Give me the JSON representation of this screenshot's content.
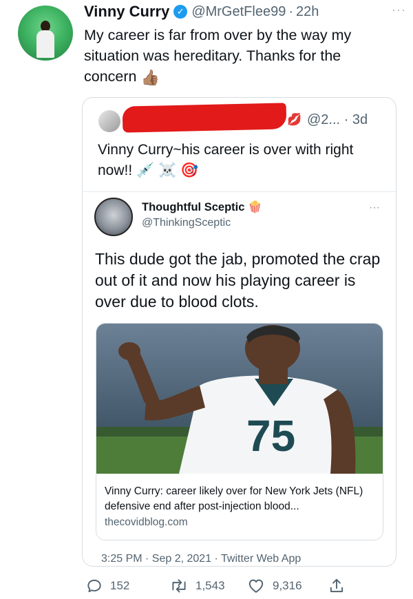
{
  "tweet": {
    "author_name": "Vinny Curry",
    "handle": "@MrGetFlee99",
    "separator": "·",
    "time_ago": "22h",
    "more": "···",
    "text": "My career is far from over by the way my situation was hereditary. Thanks for the concern",
    "thumb_emoji": "👍🏽",
    "timestamp": "3:25 PM · Sep 2, 2021 · Twitter Web App",
    "stats": {
      "replies": "152",
      "retweets": "1,543",
      "likes": "9,316"
    }
  },
  "quote": {
    "heart_emoji": "💋",
    "handle_meta": "@2... · 3d",
    "text": "Vinny Curry~his career is over with right now!!",
    "emojis": "💉 ☠️ 🎯"
  },
  "nested": {
    "author_name": "Thoughtful Sceptic",
    "name_emoji": "🍿",
    "handle": "@ThinkingSceptic",
    "more": "···",
    "text": "This dude got the jab, promoted the crap out of it and now his playing career is over due to blood clots.",
    "card": {
      "title": "Vinny Curry: career likely over for New York Jets (NFL) defensive end after post-injection blood...",
      "domain": "thecovidblog.com",
      "jersey_number": "75"
    }
  },
  "colors": {
    "accent": "#1d9bf0",
    "muted": "#536471",
    "redaction": "#e21a1a",
    "jersey_green": "#1e4b53"
  },
  "icons": [
    "verified-icon",
    "more-icon",
    "reply-icon",
    "retweet-icon",
    "like-icon",
    "share-icon"
  ]
}
